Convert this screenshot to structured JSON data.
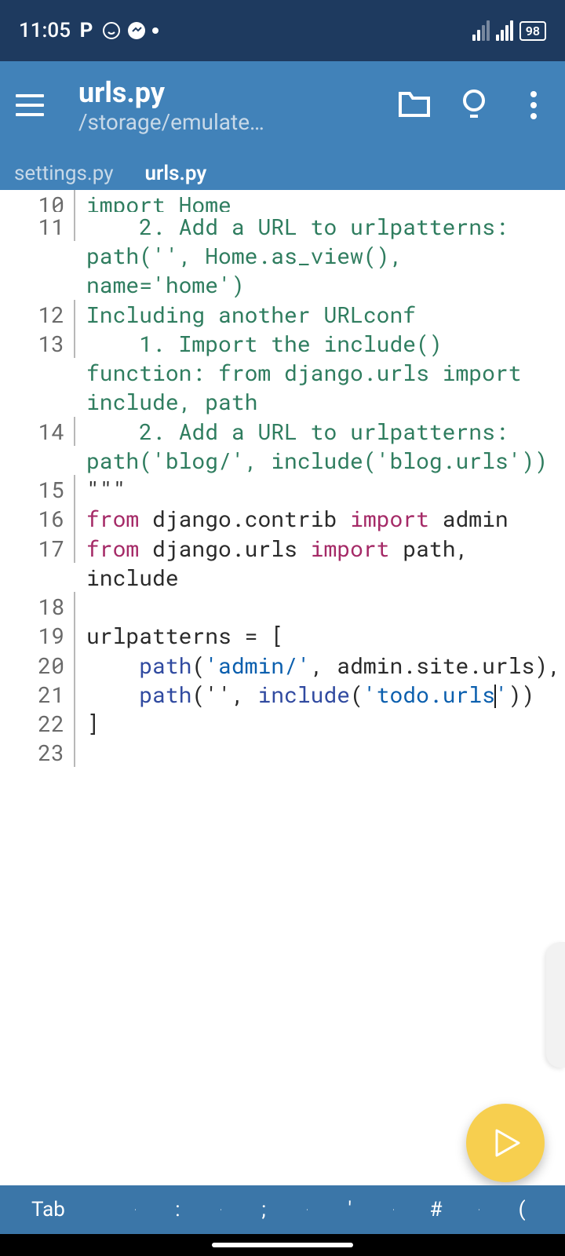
{
  "status": {
    "time": "11:05",
    "battery": "98"
  },
  "appbar": {
    "title": "urls.py",
    "subtitle": "/storage/emulate…"
  },
  "tabs": [
    {
      "label": "settings.py",
      "active": false
    },
    {
      "label": "urls.py",
      "active": true
    }
  ],
  "keyboard_keys": [
    "Tab",
    ":",
    ";",
    "'",
    "#",
    "("
  ],
  "code": {
    "lines": [
      {
        "n": 10,
        "cut": true,
        "segments": [
          {
            "t": "import Home",
            "c": "comment"
          }
        ]
      },
      {
        "n": 11,
        "segments": [
          {
            "t": "    2. Add a URL to urlpatterns:  path('', Home.as_view(), name='home')",
            "c": "comment"
          }
        ]
      },
      {
        "n": 12,
        "segments": [
          {
            "t": "Including another URLconf",
            "c": "comment"
          }
        ]
      },
      {
        "n": 13,
        "segments": [
          {
            "t": "    1. Import the include() function: from django.urls import include, path",
            "c": "comment"
          }
        ]
      },
      {
        "n": 14,
        "segments": [
          {
            "t": "    2. Add a URL to urlpatterns:  path('blog/', include('blog.urls'))",
            "c": "comment"
          }
        ]
      },
      {
        "n": 15,
        "segments": [
          {
            "t": "\"\"\"",
            "c": "default"
          }
        ]
      },
      {
        "n": 16,
        "segments": [
          {
            "t": "from",
            "c": "keyword"
          },
          {
            "t": " django.contrib ",
            "c": "default"
          },
          {
            "t": "import",
            "c": "keyword"
          },
          {
            "t": " admin",
            "c": "default"
          }
        ]
      },
      {
        "n": 17,
        "segments": [
          {
            "t": "from",
            "c": "keyword"
          },
          {
            "t": " django.urls ",
            "c": "default"
          },
          {
            "t": "import",
            "c": "keyword"
          },
          {
            "t": " path, include",
            "c": "default"
          }
        ]
      },
      {
        "n": 18,
        "segments": [
          {
            "t": "",
            "c": "default"
          }
        ]
      },
      {
        "n": 19,
        "segments": [
          {
            "t": "urlpatterns = [",
            "c": "default"
          }
        ]
      },
      {
        "n": 20,
        "segments": [
          {
            "t": "    ",
            "c": "default"
          },
          {
            "t": "path",
            "c": "func"
          },
          {
            "t": "(",
            "c": "default"
          },
          {
            "t": "'admin/'",
            "c": "string"
          },
          {
            "t": ", admin.site.urls),",
            "c": "default"
          }
        ]
      },
      {
        "n": 21,
        "cursor_after_seg": 4,
        "segments": [
          {
            "t": "    ",
            "c": "default"
          },
          {
            "t": "path",
            "c": "func"
          },
          {
            "t": "('', ",
            "c": "default"
          },
          {
            "t": "include",
            "c": "func"
          },
          {
            "t": "(",
            "c": "default"
          },
          {
            "t": "'todo.urls'",
            "c": "string"
          },
          {
            "t": "))",
            "c": "default"
          }
        ]
      },
      {
        "n": 22,
        "segments": [
          {
            "t": "]",
            "c": "default"
          }
        ]
      },
      {
        "n": 23,
        "segments": [
          {
            "t": "",
            "c": "default"
          }
        ]
      }
    ]
  }
}
